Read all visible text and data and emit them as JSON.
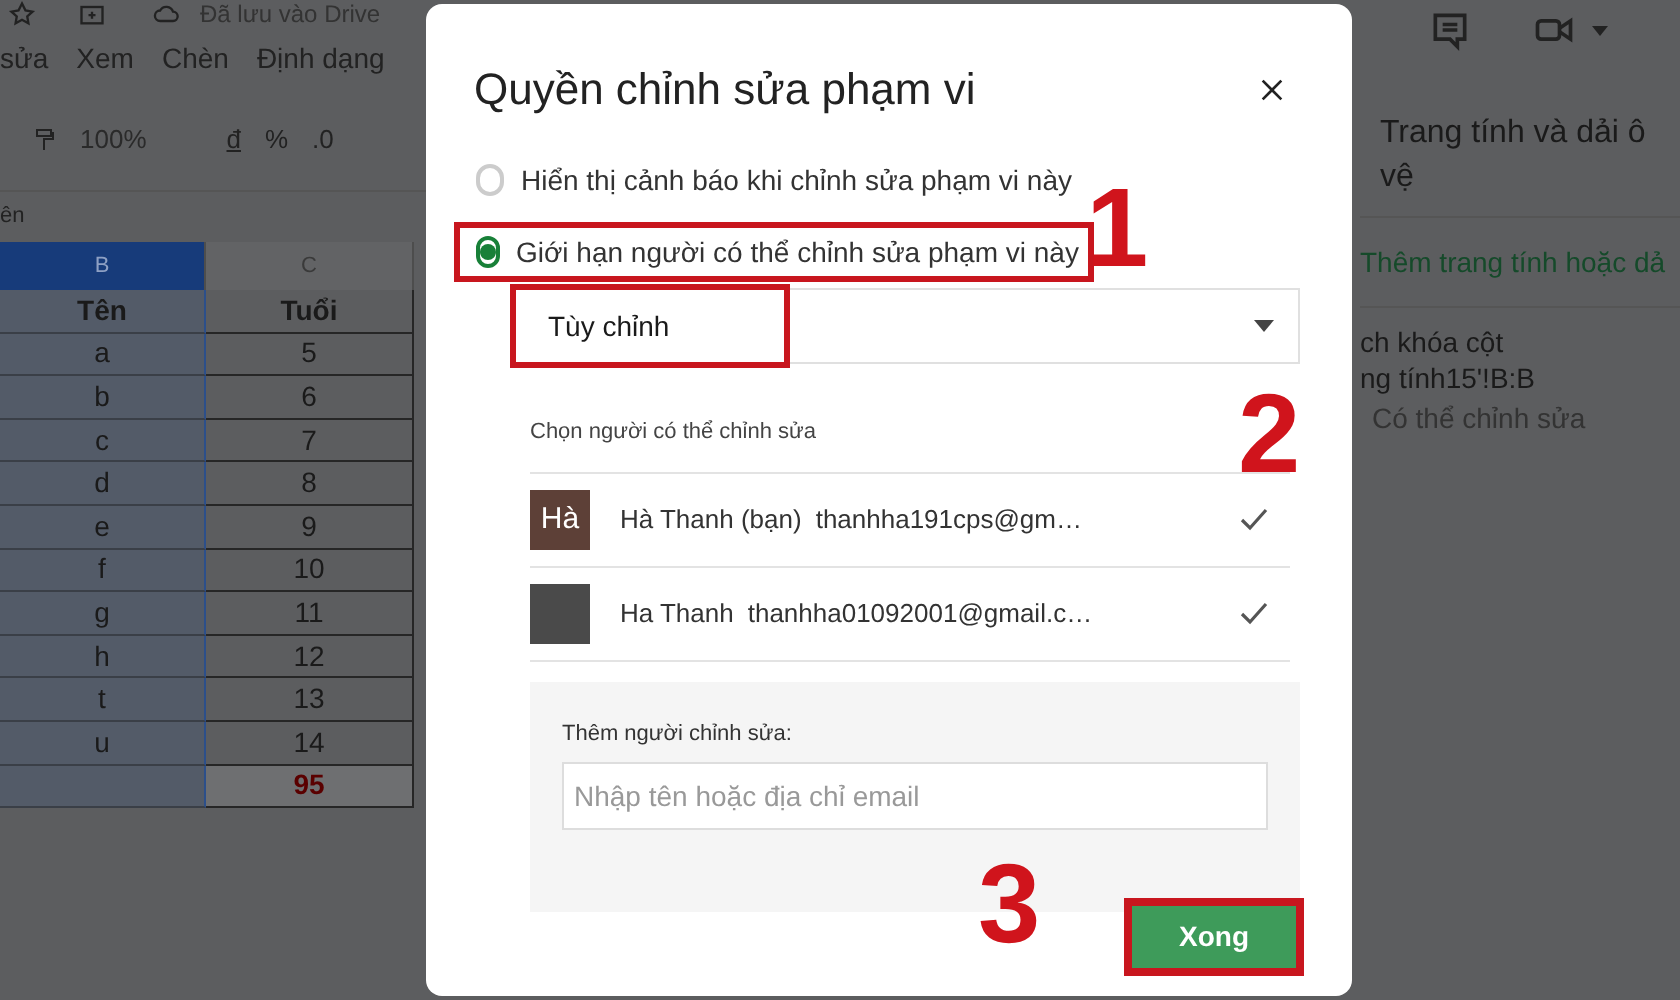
{
  "app": {
    "saved_status": "Đã lưu vào Drive",
    "menu": [
      "sửa",
      "Xem",
      "Chèn",
      "Định dạng"
    ],
    "zoom": "100%",
    "toolbar_buttons": [
      "đ",
      "%",
      ".0"
    ],
    "formula_bar": "ên"
  },
  "sheet": {
    "columns": [
      {
        "label": "B",
        "selected": true
      },
      {
        "label": "C",
        "selected": false
      }
    ],
    "rows": [
      {
        "kind": "header",
        "col_b": "Tên",
        "col_c": "Tuổi"
      },
      {
        "kind": "data",
        "col_b": "a",
        "col_c": "5"
      },
      {
        "kind": "data",
        "col_b": "b",
        "col_c": "6"
      },
      {
        "kind": "data",
        "col_b": "c",
        "col_c": "7"
      },
      {
        "kind": "data",
        "col_b": "d",
        "col_c": "8"
      },
      {
        "kind": "data",
        "col_b": "e",
        "col_c": "9"
      },
      {
        "kind": "data",
        "col_b": "f",
        "col_c": "10"
      },
      {
        "kind": "data",
        "col_b": "g",
        "col_c": "11"
      },
      {
        "kind": "data",
        "col_b": "h",
        "col_c": "12"
      },
      {
        "kind": "data",
        "col_b": "t",
        "col_c": "13"
      },
      {
        "kind": "data",
        "col_b": "u",
        "col_c": "14"
      },
      {
        "kind": "total",
        "col_c": "95"
      }
    ]
  },
  "side_panel": {
    "title_lines": [
      "Trang tính và dải ô",
      "vệ"
    ],
    "add_link": "Thêm trang tính hoặc dả",
    "range_name": "ch khóa cột",
    "range_ref": "ng tính15'!B:B",
    "permission": "Có thể chỉnh sửa"
  },
  "dialog": {
    "title": "Quyền chỉnh sửa phạm vi",
    "options": [
      {
        "label": "Hiển thị cảnh báo khi chỉnh sửa phạm vi này",
        "selected": false,
        "highlighted": false
      },
      {
        "label": "Giới hạn người có thể chỉnh sửa phạm vi này",
        "selected": true,
        "highlighted": true
      }
    ],
    "dropdown": {
      "value": "Tùy chỉnh",
      "highlighted": true
    },
    "editors_heading": "Chọn người có thể chỉnh sửa",
    "editors": [
      {
        "kind": "initials",
        "avatar_text": "Hà",
        "name": "Hà Thanh (bạn)",
        "email": "thanhha191cps@gm…",
        "checked": true
      },
      {
        "kind": "photo",
        "name": "Ha Thanh",
        "email": "thanhha01092001@gmail.c…",
        "checked": true
      }
    ],
    "add_editor": {
      "label": "Thêm người chỉnh sửa:",
      "placeholder": "Nhập tên hoặc địa chỉ email"
    },
    "done_button": {
      "label": "Xong",
      "highlighted": true
    }
  },
  "annotations": [
    {
      "label": "1"
    },
    {
      "label": "2"
    },
    {
      "label": "3"
    }
  ]
}
